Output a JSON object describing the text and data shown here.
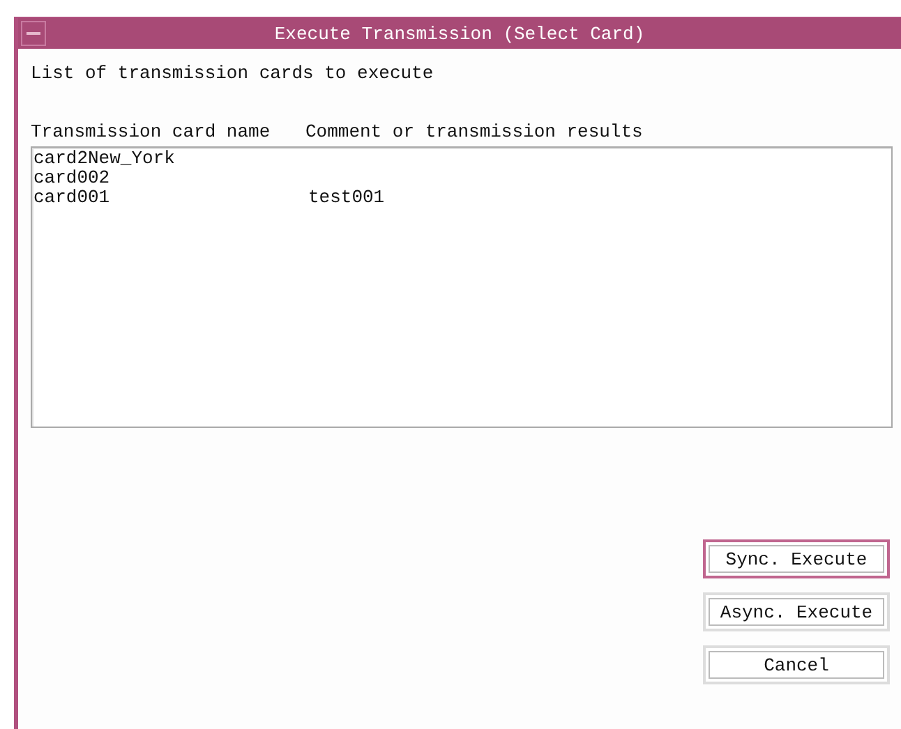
{
  "window": {
    "title": "Execute Transmission (Select Card)"
  },
  "intro": "List of transmission cards to execute",
  "table": {
    "columns": [
      "Transmission card name",
      "Comment or transmission results"
    ],
    "rows": [
      {
        "cells": [
          "card2New_York",
          ""
        ]
      },
      {
        "cells": [
          "card002",
          ""
        ]
      },
      {
        "cells": [
          "card001",
          "test001"
        ]
      }
    ]
  },
  "buttons": [
    {
      "label": "Sync. Execute",
      "focused": true
    },
    {
      "label": "Async. Execute",
      "focused": false
    },
    {
      "label": "Cancel",
      "focused": false
    }
  ]
}
